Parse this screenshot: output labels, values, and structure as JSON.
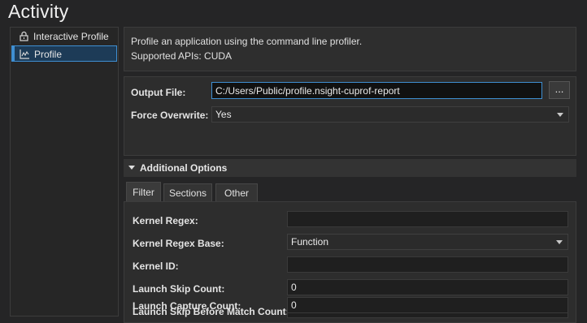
{
  "title": "Activity",
  "sidebar": {
    "items": [
      {
        "label": "Interactive Profile",
        "icon": "lock-icon",
        "active": false
      },
      {
        "label": "Profile",
        "icon": "chart-icon",
        "active": true
      }
    ]
  },
  "description": {
    "line1": "Profile an application using the command line profiler.",
    "line2": "Supported APIs: CUDA"
  },
  "output": {
    "output_file_label": "Output File:",
    "output_file_value": "C:/Users/Public/profile.nsight-cuprof-report",
    "browse_label": "...",
    "force_overwrite_label": "Force Overwrite:",
    "force_overwrite_value": "Yes"
  },
  "additional_options": {
    "header": "Additional Options",
    "tabs": [
      {
        "label": "Filter",
        "active": true
      },
      {
        "label": "Sections",
        "active": false
      },
      {
        "label": "Other",
        "active": false
      }
    ],
    "filter": {
      "kernel_regex_label": "Kernel Regex:",
      "kernel_regex_value": "",
      "kernel_regex_base_label": "Kernel Regex Base:",
      "kernel_regex_base_value": "Function",
      "kernel_id_label": "Kernel ID:",
      "kernel_id_value": "",
      "launch_skip_count_label": "Launch Skip Count:",
      "launch_skip_count_value": "0",
      "launch_skip_before_match_label": "Launch Skip Before Match Count:",
      "launch_skip_before_match_value": "0",
      "launch_capture_count_label": "Launch Capture Count:",
      "launch_capture_count_value": "0"
    }
  },
  "colors": {
    "background": "#252526",
    "accent": "#3f8fd2",
    "selected_bg": "#1d3b57"
  }
}
